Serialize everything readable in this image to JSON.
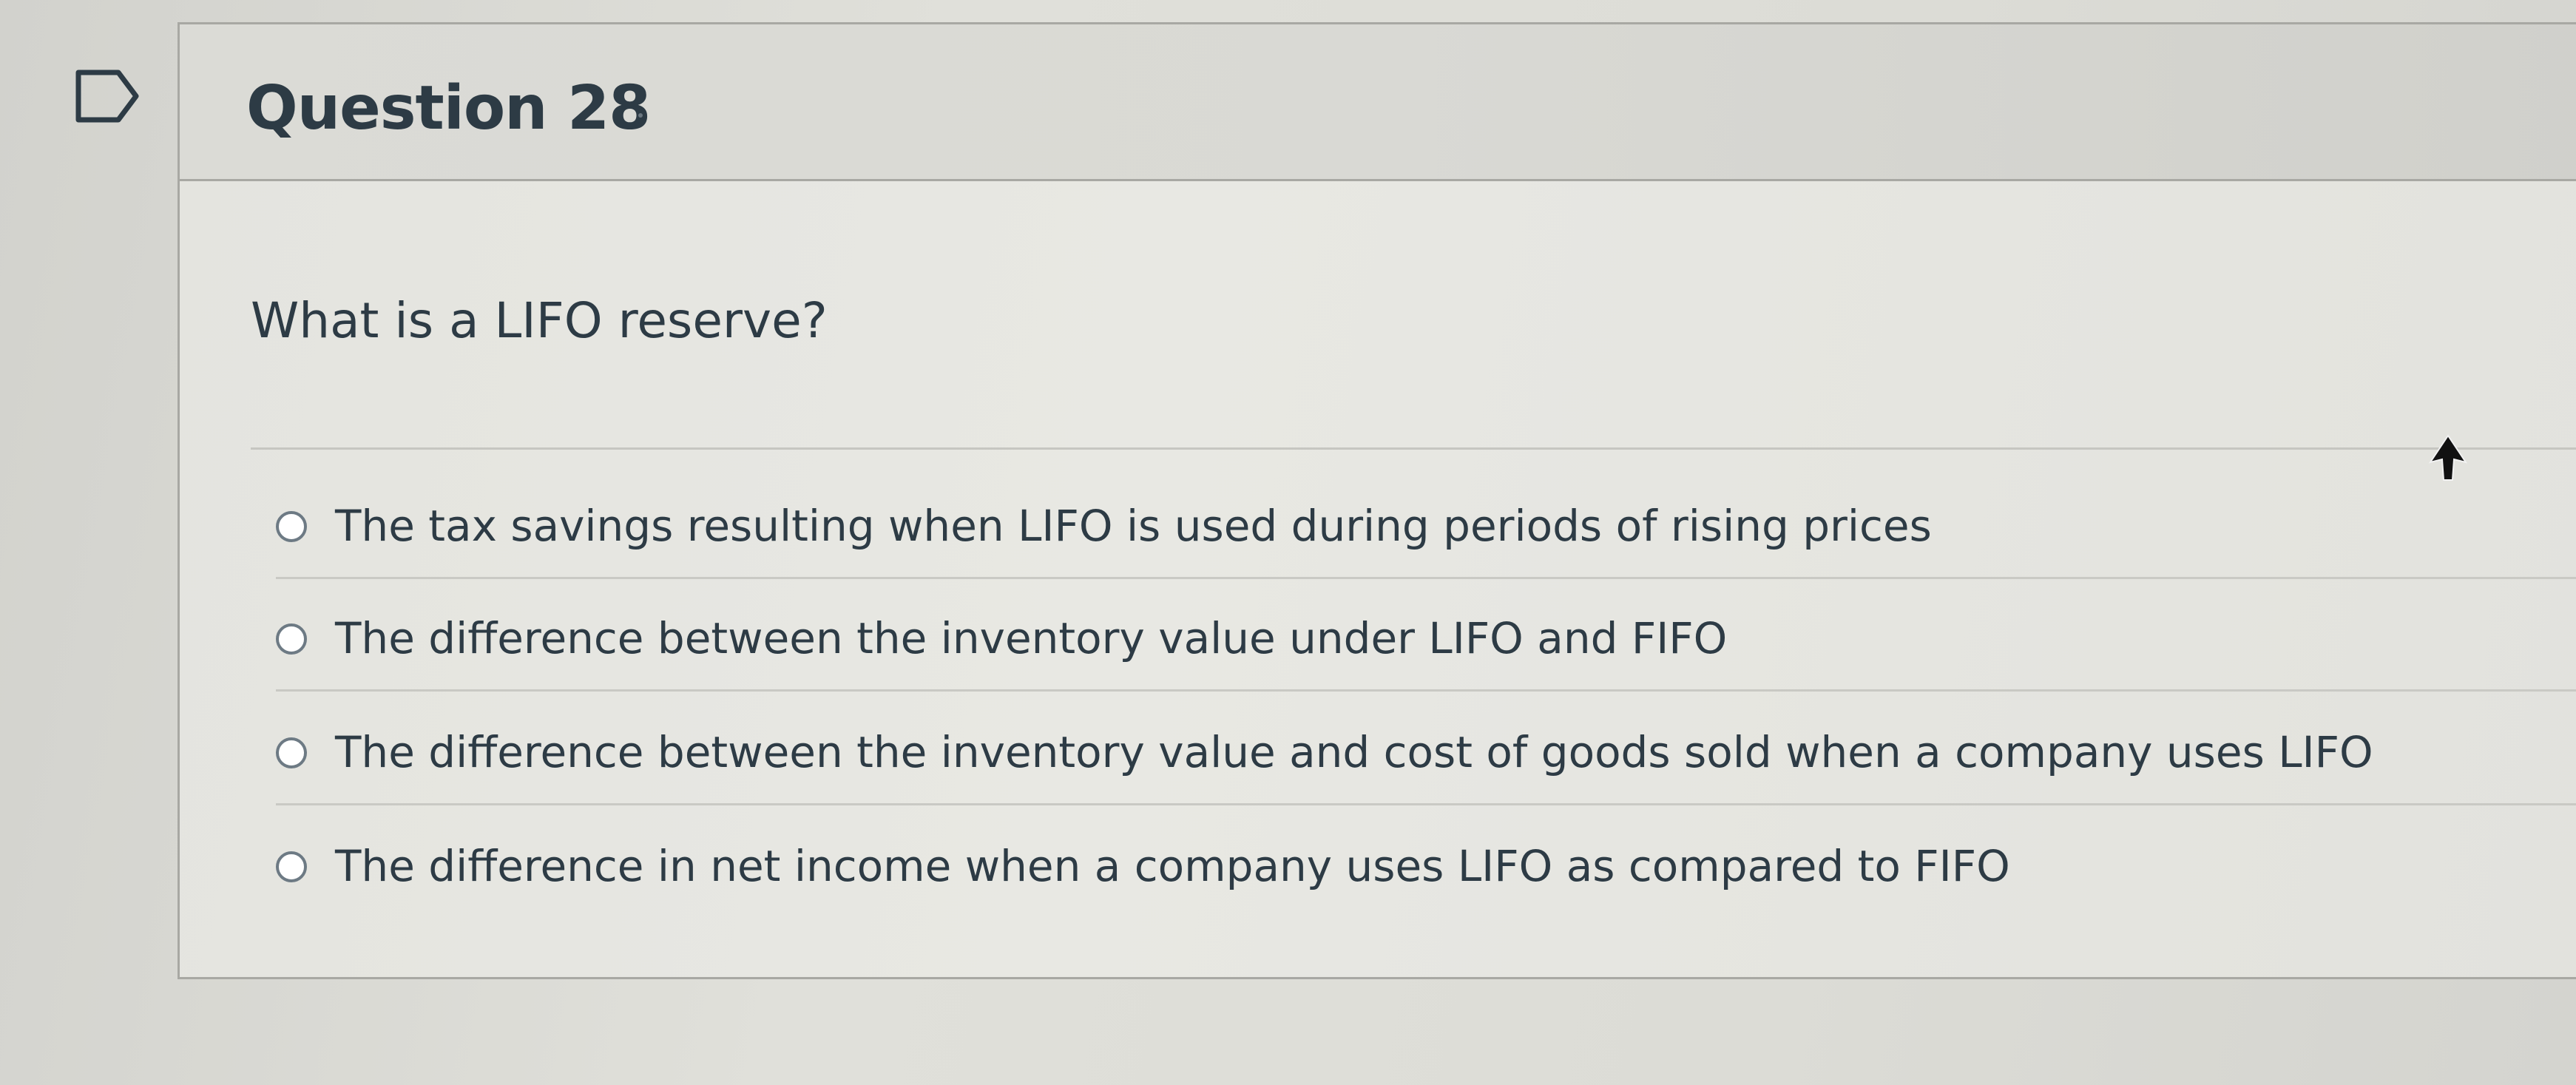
{
  "question": {
    "title": "Question 28",
    "prompt": "What is a LIFO reserve?",
    "answers": [
      {
        "label": "The tax savings resulting when LIFO is used during periods of rising prices",
        "selected": false
      },
      {
        "label": "The difference between the inventory value under LIFO and FIFO",
        "selected": false
      },
      {
        "label": "The difference between the inventory value and cost of goods sold when a company uses LIFO",
        "selected": false
      },
      {
        "label": "The difference in net income when a company uses LIFO as compared to FIFO",
        "selected": false
      }
    ]
  },
  "icons": {
    "bookmark": "bookmark-flag-icon",
    "radio": "radio-unselected-icon",
    "cursor": "mouse-pointer-icon"
  },
  "colors": {
    "text": "#2d3b45",
    "border": "#a8a8a3",
    "radio_border": "#6d7a84"
  }
}
